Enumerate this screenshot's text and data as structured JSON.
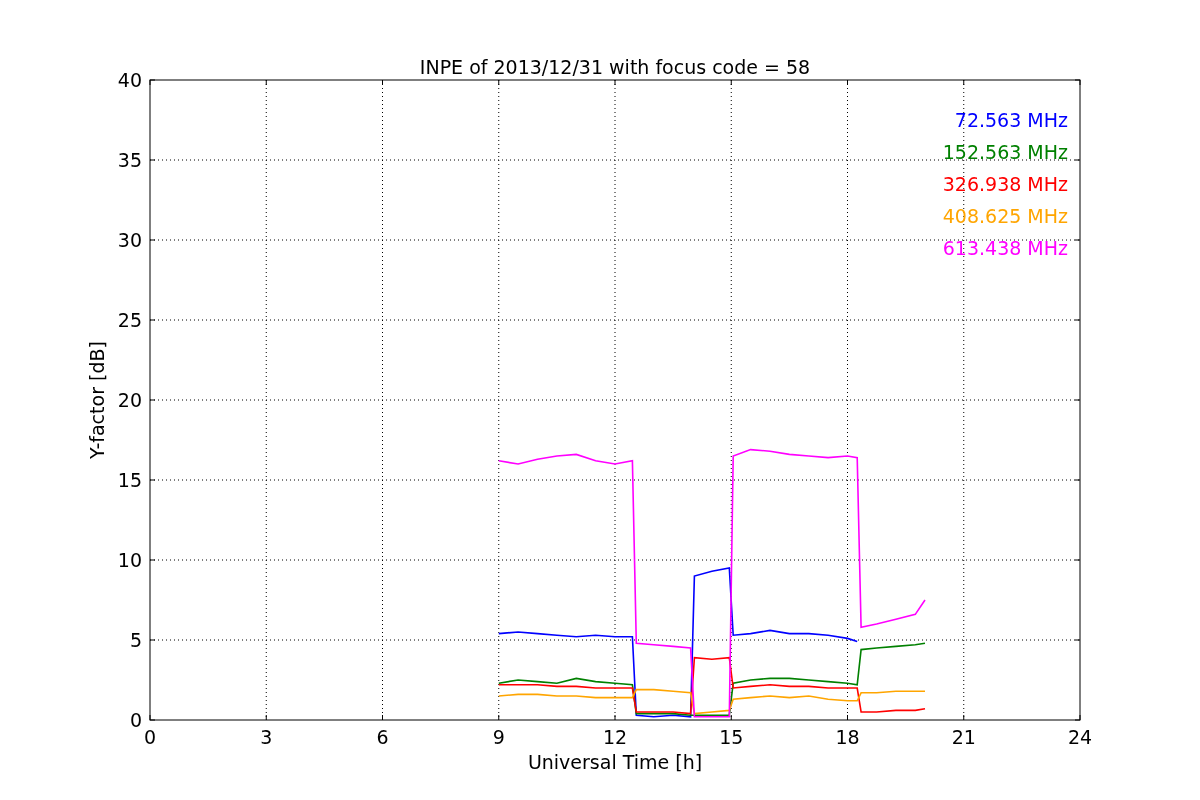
{
  "chart": {
    "chart_data": {
      "type": "line",
      "title": "INPE of 2013/12/31 with focus code = 58",
      "xlabel": "Universal Time [h]",
      "ylabel": "Y-factor [dB]",
      "x": [
        9,
        9.5,
        10,
        10.5,
        11,
        11.5,
        12,
        12.45,
        12.55,
        13,
        13.5,
        13.95,
        14.05,
        14.5,
        14.95,
        15.05,
        15.5,
        16,
        16.5,
        17,
        17.5,
        18,
        18.25,
        18.35,
        18.75,
        19.25,
        19.75,
        20
      ],
      "series": [
        {
          "name": "72.563 MHz",
          "color": "#0000ff",
          "values": [
            5.4,
            5.5,
            5.4,
            5.3,
            5.2,
            5.3,
            5.2,
            5.2,
            0.3,
            0.2,
            0.3,
            0.2,
            9.0,
            9.3,
            9.5,
            5.3,
            5.4,
            5.6,
            5.4,
            5.4,
            5.3,
            5.1,
            4.9,
            null,
            null,
            null,
            null,
            null
          ]
        },
        {
          "name": "152.563 MHz",
          "color": "#008000",
          "values": [
            2.3,
            2.5,
            2.4,
            2.3,
            2.6,
            2.4,
            2.3,
            2.2,
            0.4,
            0.4,
            0.4,
            0.3,
            0.3,
            0.3,
            0.3,
            2.3,
            2.5,
            2.6,
            2.6,
            2.5,
            2.4,
            2.3,
            2.2,
            4.4,
            4.5,
            4.6,
            4.7,
            4.8
          ]
        },
        {
          "name": "326.938 MHz",
          "color": "#ff0000",
          "values": [
            2.2,
            2.2,
            2.2,
            2.1,
            2.1,
            2.0,
            2.0,
            2.0,
            0.5,
            0.5,
            0.5,
            0.4,
            3.9,
            3.8,
            3.9,
            2.0,
            2.1,
            2.2,
            2.1,
            2.1,
            2.0,
            2.0,
            2.0,
            0.5,
            0.5,
            0.6,
            0.6,
            0.7
          ]
        },
        {
          "name": "408.625 MHz",
          "color": "#ffa500",
          "values": [
            1.5,
            1.6,
            1.6,
            1.5,
            1.5,
            1.4,
            1.4,
            1.4,
            1.9,
            1.9,
            1.8,
            1.7,
            0.4,
            0.5,
            0.6,
            1.3,
            1.4,
            1.5,
            1.4,
            1.5,
            1.3,
            1.2,
            1.2,
            1.7,
            1.7,
            1.8,
            1.8,
            1.8
          ]
        },
        {
          "name": "613.438 MHz",
          "color": "#ff00ff",
          "values": [
            16.2,
            16.0,
            16.3,
            16.5,
            16.6,
            16.2,
            16.0,
            16.2,
            4.8,
            4.7,
            4.6,
            4.5,
            0.2,
            0.2,
            0.2,
            16.5,
            16.9,
            16.8,
            16.6,
            16.5,
            16.4,
            16.5,
            16.4,
            5.8,
            6.0,
            6.3,
            6.6,
            7.5
          ]
        }
      ],
      "grid": true,
      "xlim": [
        0,
        24
      ],
      "ylim": [
        0,
        40
      ],
      "xticks": [
        0,
        3,
        6,
        9,
        12,
        15,
        18,
        21,
        24
      ],
      "yticks": [
        0,
        5,
        10,
        15,
        20,
        25,
        30,
        35,
        40
      ]
    }
  }
}
